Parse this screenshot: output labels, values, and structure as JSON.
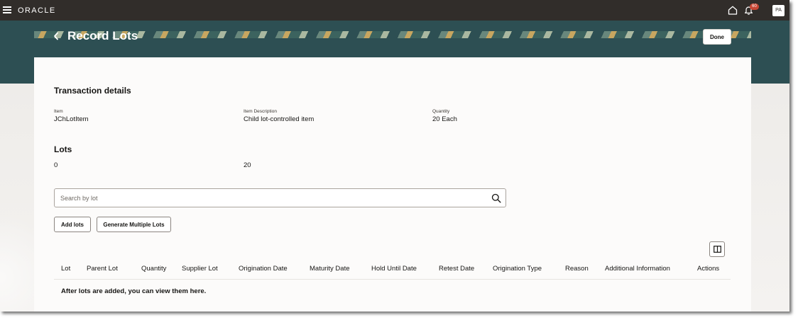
{
  "topbar": {
    "brand": "ORACLE",
    "notification_count": "60",
    "user_initials": "PA"
  },
  "header": {
    "title": "Record Lots",
    "done_label": "Done"
  },
  "transaction": {
    "section_title": "Transaction details",
    "item_label": "Item",
    "item_value": "JChLotItem",
    "description_label": "Item Description",
    "description_value": "Child lot-controlled item",
    "quantity_label": "Quantity",
    "quantity_value": "20 Each"
  },
  "lots": {
    "section_title": "Lots",
    "recorded_count": "0",
    "total_count": "20"
  },
  "search": {
    "placeholder": "Search by lot",
    "value": ""
  },
  "actions": {
    "add_lots": "Add lots",
    "generate_multiple": "Generate Multiple Lots"
  },
  "table": {
    "columns": [
      "Lot",
      "Parent Lot",
      "Quantity",
      "Supplier Lot",
      "Origination Date",
      "Maturity Date",
      "Hold Until Date",
      "Retest Date",
      "Origination Type",
      "Reason",
      "Additional Information",
      "Actions"
    ],
    "empty_message": "After lots are added, you can view them here."
  },
  "colors": {
    "topbar": "#312d2a",
    "banner": "#2d4f53",
    "badge": "#c74634"
  }
}
